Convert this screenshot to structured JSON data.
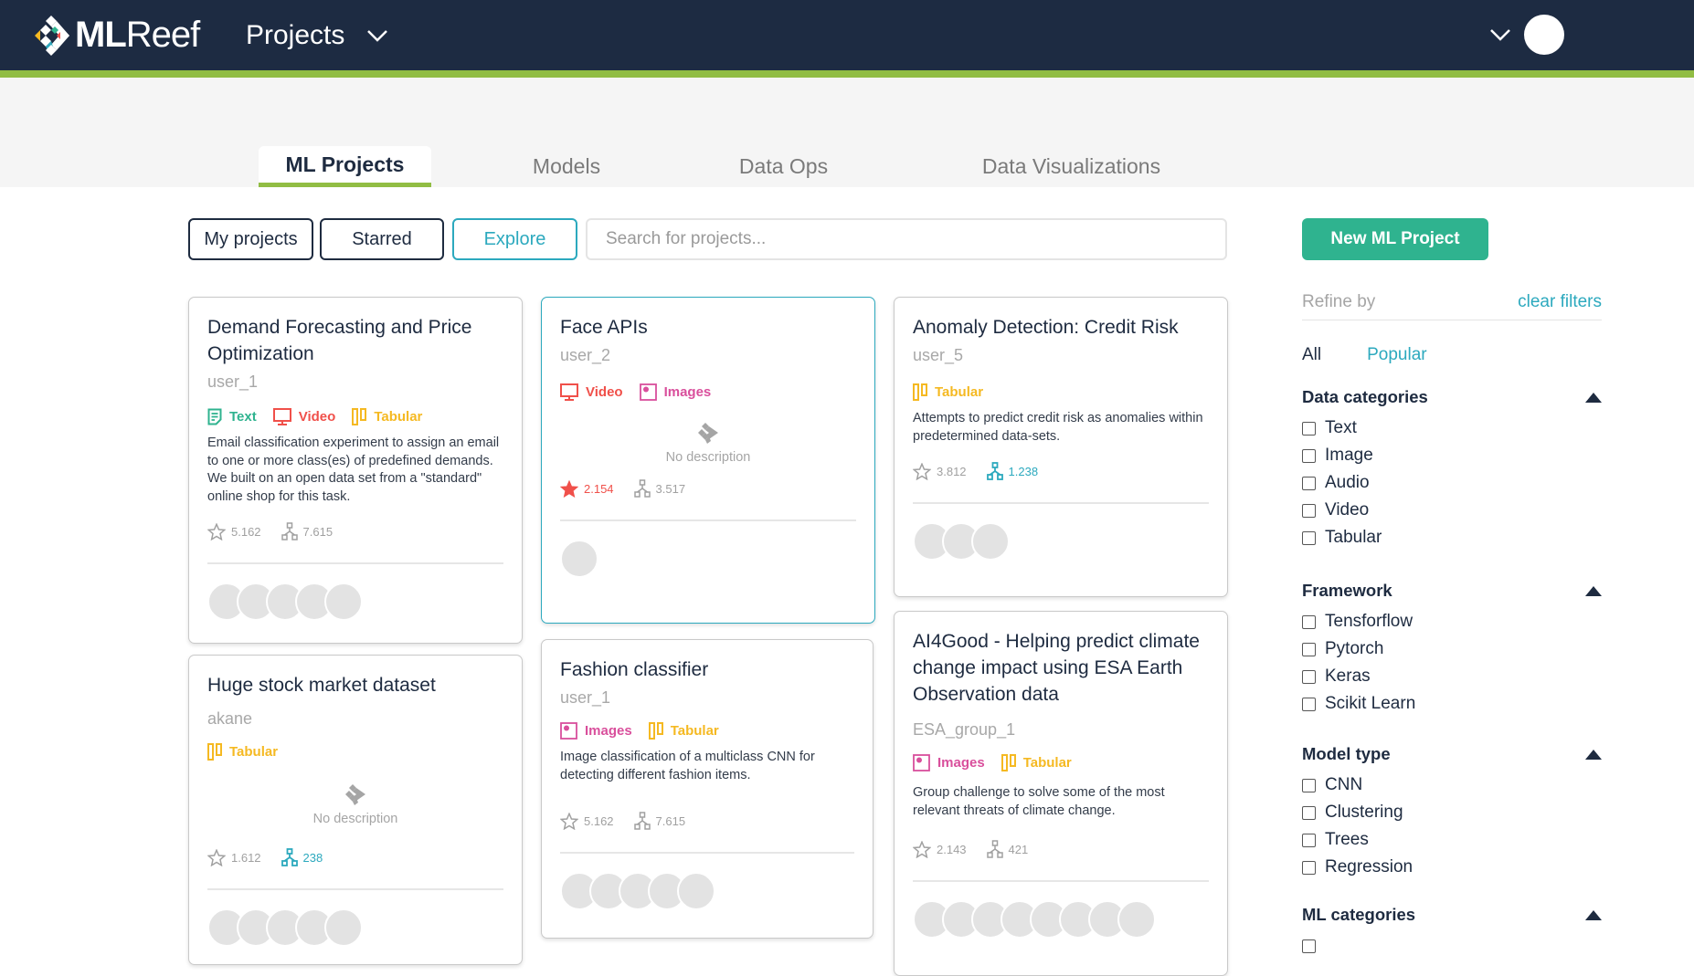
{
  "header": {
    "brand_bold": "ML",
    "brand_light": "Reef",
    "nav_label": "Projects"
  },
  "tabs": [
    {
      "label": "ML Projects",
      "active": true
    },
    {
      "label": "Models",
      "active": false
    },
    {
      "label": "Data Ops",
      "active": false
    },
    {
      "label": "Data Visualizations",
      "active": false
    }
  ],
  "filters": {
    "my_projects": "My projects",
    "starred": "Starred",
    "explore": "Explore",
    "search_placeholder": "Search for projects..."
  },
  "new_project_label": "New ML Project",
  "colors": {
    "header_bg": "#1d2b42",
    "accent_green": "#91bd44",
    "primary_teal": "#2fb38f",
    "link_blue": "#2ca9be",
    "text_tag": "#2fb38f",
    "video_tag": "#f0504a",
    "images_tag": "#d94f9c",
    "tabular_tag": "#f5b922"
  },
  "cards": [
    {
      "title": "Demand Forecasting and Price Optimization",
      "owner": "user_1",
      "tags": [
        "Text",
        "Video",
        "Tabular"
      ],
      "description": "Email classification experiment to assign an email to one or more class(es) of predefined demands. We built on an open data set from a \"standard\" online shop for this task.",
      "stars": "5.162",
      "forks": "7.615",
      "contributors": 5
    },
    {
      "title": "Face APIs",
      "owner": "user_2",
      "tags": [
        "Video",
        "Images"
      ],
      "description": "No description",
      "stars": "2.154",
      "forks": "3.517",
      "starred": true,
      "contributors": 1
    },
    {
      "title": "Anomaly Detection: Credit Risk",
      "owner": "user_5",
      "tags": [
        "Tabular"
      ],
      "description": "Attempts to predict credit risk as anomalies within predetermined data-sets.",
      "stars": "3.812",
      "forks": "1.238",
      "forked": true,
      "contributors": 3
    },
    {
      "title": "Huge stock market dataset",
      "owner": "akane",
      "tags": [
        "Tabular"
      ],
      "description": "No description",
      "stars": "1.612",
      "forks": "238",
      "forked": true,
      "contributors": 5
    },
    {
      "title": "Fashion classifier",
      "owner": "user_1",
      "tags": [
        "Images",
        "Tabular"
      ],
      "description": "Image classification of a multiclass CNN for detecting different fashion items.",
      "stars": "5.162",
      "forks": "7.615",
      "contributors": 5
    },
    {
      "title": "AI4Good - Helping predict climate change impact using ESA Earth Observation data",
      "owner": "ESA_group_1",
      "tags": [
        "Images",
        "Tabular"
      ],
      "description": "Group challenge to solve some of the most relevant threats of climate change.",
      "stars": "2.143",
      "forks": "421",
      "contributors": 8
    }
  ],
  "sidebar": {
    "refine_label": "Refine by",
    "clear_label": "clear filters",
    "quick_all": "All",
    "quick_popular": "Popular",
    "groups": [
      {
        "title": "Data categories",
        "options": [
          "Text",
          "Image",
          "Audio",
          "Video",
          "Tabular"
        ]
      },
      {
        "title": "Framework",
        "options": [
          "Tensforflow",
          "Pytorch",
          "Keras",
          "Scikit Learn"
        ]
      },
      {
        "title": "Model type",
        "options": [
          "CNN",
          "Clustering",
          "Trees",
          "Regression"
        ]
      },
      {
        "title": "ML categories",
        "options": []
      }
    ]
  }
}
